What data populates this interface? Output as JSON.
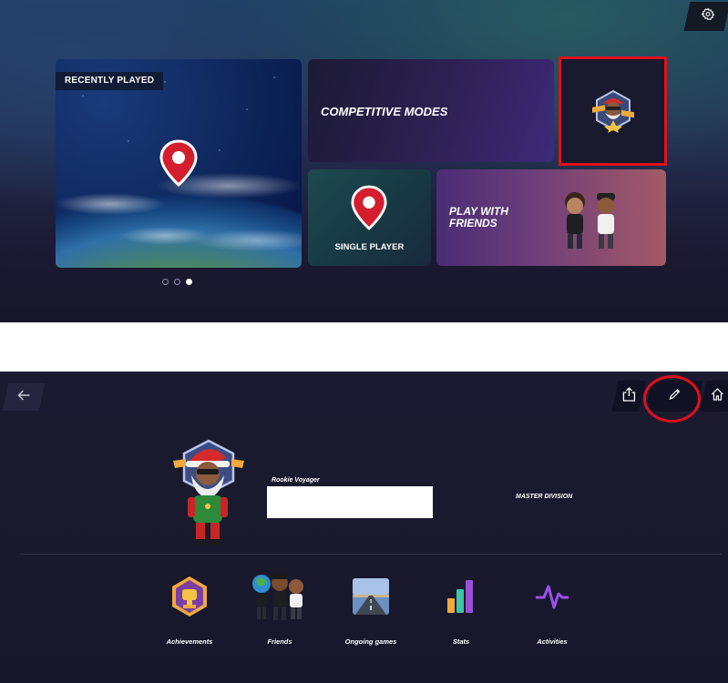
{
  "top_panel": {
    "settings_icon": "gear-icon",
    "recently_played": {
      "tag": "RECENTLY PLAYED",
      "icon": "map-pin-icon"
    },
    "competitive_modes": {
      "title": "COMPETITIVE MODES"
    },
    "avatar_card": {
      "icon": "avatar-badge-icon",
      "highlight_color": "#e0101b"
    },
    "single_player": {
      "label": "SINGLE PLAYER",
      "icon": "map-pin-icon"
    },
    "play_with_friends": {
      "title": "PLAY WITH\nFRIENDS"
    },
    "carousel": {
      "pages": 3,
      "active_index": 2
    }
  },
  "profile_panel": {
    "back_icon": "arrow-left-icon",
    "share_icon": "share-icon",
    "edit_icon": "pencil-icon",
    "home_icon": "home-icon",
    "edit_highlight_color": "#e0101b",
    "rank_title": "Rookie Voyager",
    "division": "MASTER DIVISION",
    "nav": [
      {
        "label": "Achievements",
        "icon": "trophy-icon"
      },
      {
        "label": "Friends",
        "icon": "friends-icon"
      },
      {
        "label": "Ongoing games",
        "icon": "road-icon"
      },
      {
        "label": "Stats",
        "icon": "bar-chart-icon"
      },
      {
        "label": "Activities",
        "icon": "pulse-icon"
      }
    ]
  }
}
